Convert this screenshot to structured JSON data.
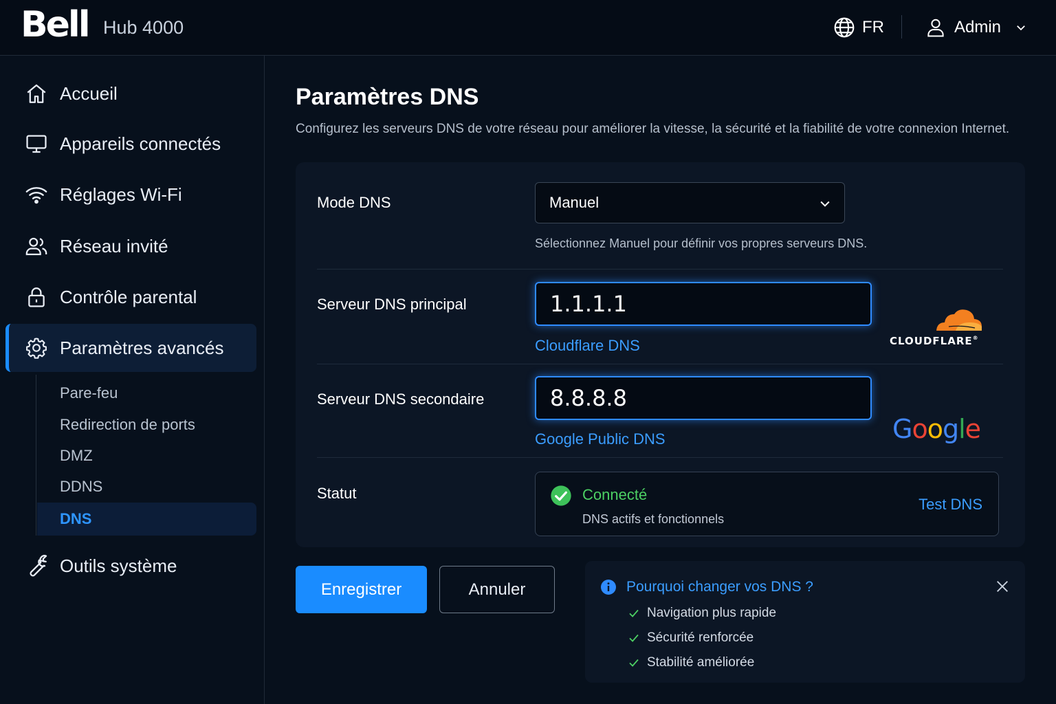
{
  "header": {
    "logo_text": "Bell",
    "product_name": "Hub 4000",
    "language": "FR",
    "user_name": "Admin"
  },
  "sidebar": {
    "items": [
      {
        "label": "Accueil",
        "icon": "home-icon"
      },
      {
        "label": "Appareils connectés",
        "icon": "monitor-icon"
      },
      {
        "label": "Réglages Wi-Fi",
        "icon": "wifi-icon"
      },
      {
        "label": "Réseau invité",
        "icon": "users-icon"
      },
      {
        "label": "Contrôle parental",
        "icon": "lock-icon"
      },
      {
        "label": "Paramètres avancés",
        "icon": "gear-icon",
        "active": true
      },
      {
        "label": "Outils système",
        "icon": "wrench-icon"
      }
    ],
    "subitems": [
      {
        "label": "Pare-feu"
      },
      {
        "label": "Redirection de ports"
      },
      {
        "label": "DMZ"
      },
      {
        "label": "DDNS"
      },
      {
        "label": "DNS",
        "active": true
      }
    ]
  },
  "main": {
    "title": "Paramètres DNS",
    "description": "Configurez les serveurs DNS de votre réseau pour améliorer la vitesse, la sécurité et la fiabilité de votre connexion Internet.",
    "dns_mode": {
      "label": "Mode DNS",
      "value": "Manuel",
      "hint": "Sélectionnez Manuel pour définir vos propres serveurs DNS."
    },
    "primary": {
      "label": "Serveur DNS principal",
      "value": "1.1.1.1",
      "provider": "Cloudflare DNS",
      "logo_text": "CLOUDFLARE",
      "logo_mark": "®"
    },
    "secondary": {
      "label": "Serveur DNS secondaire",
      "value": "8.8.8.8",
      "provider": "Google Public DNS",
      "logo_letters": [
        "G",
        "o",
        "o",
        "g",
        "l",
        "e"
      ]
    },
    "status": {
      "label": "Statut",
      "title": "Connecté",
      "subtitle": "DNS actifs et fonctionnels",
      "test_link": "Test DNS"
    },
    "buttons": {
      "save": "Enregistrer",
      "cancel": "Annuler"
    },
    "info": {
      "title": "Pourquoi changer vos DNS ?",
      "items": [
        "Navigation plus rapide",
        "Sécurité renforcée",
        "Stabilité améliorée"
      ]
    }
  },
  "colors": {
    "accent": "#1a8cff",
    "link": "#3b9dff",
    "success": "#4ccf63",
    "background": "#07101c",
    "card": "#0c1625",
    "cloudflare_orange": "#f38020",
    "google_blue": "#4285f4",
    "google_red": "#ea4335",
    "google_yellow": "#fbbc05",
    "google_green": "#34a853"
  }
}
